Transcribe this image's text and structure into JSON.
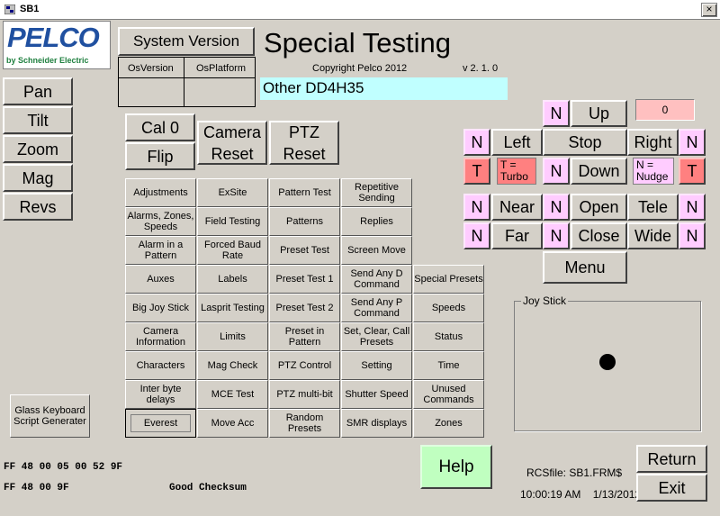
{
  "window": {
    "title": "SB1",
    "close": "×"
  },
  "logo": {
    "brand": "PELCO",
    "tagline": "by Schneider Electric"
  },
  "system_version": {
    "label": "System Version",
    "col1": "OsVersion",
    "col2": "OsPlatform",
    "val1": "",
    "val2": ""
  },
  "header": {
    "title": "Special Testing",
    "copyright": "Copyright Pelco 2012",
    "version": "v 2. 1. 0",
    "device": "Other DD4H35"
  },
  "left_buttons": [
    "Pan",
    "Tilt",
    "Zoom",
    "Mag",
    "Revs"
  ],
  "cal_buttons": {
    "cal0": "Cal 0",
    "flip": "Flip",
    "camera_reset": "Camera Reset",
    "ptz_reset": "PTZ Reset"
  },
  "grid": [
    [
      "Adjustments",
      "ExSite",
      "Pattern Test",
      "Repetitive Sending"
    ],
    [
      "Alarms, Zones, Speeds",
      "Field Testing",
      "Patterns",
      "Replies"
    ],
    [
      "Alarm in a Pattern",
      "Forced Baud Rate",
      "Preset Test",
      "Screen Move"
    ],
    [
      "Auxes",
      "Labels",
      "Preset Test 1",
      "Send Any D Command",
      "Special Presets"
    ],
    [
      "Big Joy Stick",
      "Lasprit Testing",
      "Preset Test 2",
      "Send Any P Command",
      "Speeds"
    ],
    [
      "Camera Information",
      "Limits",
      "Preset in Pattern",
      "Set, Clear, Call Presets",
      "Status"
    ],
    [
      "Characters",
      "Mag Check",
      "PTZ Control",
      "Setting",
      "Time"
    ],
    [
      "Inter byte delays",
      "MCE Test",
      "PTZ multi-bit",
      "Shutter Speed",
      "Unused Commands"
    ],
    [
      "Everest",
      "Move Acc",
      "Random Presets",
      "SMR displays",
      "Zones"
    ]
  ],
  "glass_keyboard": "Glass Keyboard Script Generater",
  "hex": {
    "line1": "FF 48 00 05 00 52 9F",
    "line2": "FF 48 00 9F",
    "checksum": "Good Checksum"
  },
  "ptz": {
    "counter": "0",
    "up": "Up",
    "left": "Left",
    "stop": "Stop",
    "right": "Right",
    "down": "Down",
    "n": "N",
    "t": "T",
    "turbo": "T = Turbo",
    "nudge": "N = Nudge",
    "near": "Near",
    "far": "Far",
    "open": "Open",
    "close": "Close",
    "tele": "Tele",
    "wide": "Wide",
    "menu": "Menu"
  },
  "joystick": {
    "label": "Joy Stick"
  },
  "help": "Help",
  "rcs_file": "RCSfile: SB1.FRM$",
  "datetime": "10:00:19 AM    1/13/2012",
  "return": "Return",
  "exit": "Exit",
  "colors": {
    "pink": "#ffccff",
    "red": "#ff8080",
    "cyan": "#c0ffff",
    "help_green": "#c0ffc0"
  }
}
